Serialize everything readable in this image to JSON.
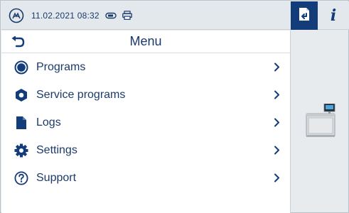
{
  "statusbar": {
    "datetime": "11.02.2021 08:32",
    "logo_icon": "brand-logo-icon",
    "icons": [
      "usb-stick-icon",
      "printer-icon"
    ]
  },
  "tabs": {
    "active_icon": "return-document-icon",
    "info_label": "i"
  },
  "menu": {
    "title": "Menu",
    "back_icon": "back-arrow-icon",
    "items": [
      {
        "label": "Programs",
        "icon": "program-circle-icon"
      },
      {
        "label": "Service programs",
        "icon": "service-hexagon-icon"
      },
      {
        "label": "Logs",
        "icon": "document-icon"
      },
      {
        "label": "Settings",
        "icon": "gear-icon"
      },
      {
        "label": "Support",
        "icon": "help-circle-icon"
      }
    ]
  },
  "colors": {
    "accent": "#123c7a",
    "text": "#1b3a6a",
    "background": "#e7ebee"
  }
}
